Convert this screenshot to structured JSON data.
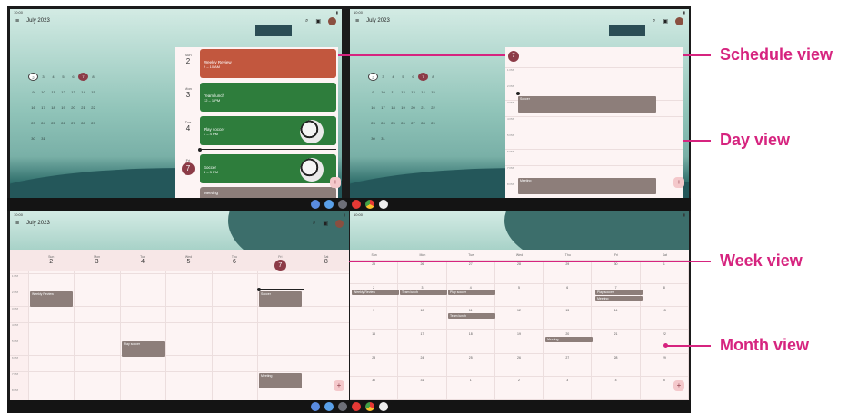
{
  "app": {
    "month_title": "July 2023"
  },
  "mini_calendar": [
    "2",
    "3",
    "4",
    "5",
    "6",
    "7",
    "8",
    "9",
    "10",
    "11",
    "12",
    "13",
    "14",
    "15",
    "16",
    "17",
    "18",
    "19",
    "20",
    "21",
    "22",
    "23",
    "24",
    "25",
    "26",
    "27",
    "28",
    "29",
    "30",
    "31"
  ],
  "schedule": [
    {
      "dow": "Sun",
      "day": "2",
      "title": "Weekly Review",
      "time": "9 – 10 AM",
      "color": "#c2573e"
    },
    {
      "dow": "Mon",
      "day": "3",
      "title": "Team lunch",
      "time": "12 – 1 PM",
      "color": "#2e7d3c"
    },
    {
      "dow": "Tue",
      "day": "4",
      "title": "Play soccer",
      "time": "3 – 4 PM",
      "color": "#2e7d3c"
    },
    {
      "dow": "Fri",
      "day": "7",
      "title": "Soccer",
      "time": "2 – 3 PM",
      "color": "#2e7d3c"
    },
    {
      "dow": "",
      "day": "",
      "title": "Meeting",
      "time": "",
      "color": "#8d7e7a"
    }
  ],
  "day_view": {
    "hours": [
      "1 PM",
      "2 PM",
      "3 PM",
      "4 PM",
      "5 PM",
      "6 PM",
      "7 PM",
      "8 PM",
      "9 PM"
    ],
    "events": [
      {
        "title": "Soccer"
      },
      {
        "title": "Meeting"
      }
    ]
  },
  "week_view": {
    "days": [
      {
        "dow": "Sun",
        "num": "2"
      },
      {
        "dow": "Mon",
        "num": "3"
      },
      {
        "dow": "Tue",
        "num": "4"
      },
      {
        "dow": "Wed",
        "num": "5"
      },
      {
        "dow": "Thu",
        "num": "6"
      },
      {
        "dow": "Fri",
        "num": "7"
      },
      {
        "dow": "Sat",
        "num": "8"
      }
    ],
    "hours": [
      "1 PM",
      "2 PM",
      "3 PM",
      "4 PM",
      "5 PM",
      "6 PM",
      "7 PM",
      "8 PM",
      "9 PM"
    ],
    "events": [
      {
        "title": "Weekly Review"
      },
      {
        "title": "Play soccer"
      },
      {
        "title": "Soccer"
      },
      {
        "title": "Meeting"
      }
    ]
  },
  "month_view": {
    "days_of_week": [
      "Sun",
      "Mon",
      "Tue",
      "Wed",
      "Thu",
      "Fri",
      "Sat"
    ],
    "cells": [
      "25",
      "26",
      "27",
      "28",
      "29",
      "30",
      "1",
      "2",
      "3",
      "4",
      "5",
      "6",
      "7",
      "8",
      "9",
      "10",
      "11",
      "12",
      "13",
      "14",
      "15",
      "16",
      "17",
      "18",
      "19",
      "20",
      "21",
      "22",
      "23",
      "24",
      "25",
      "26",
      "27",
      "28",
      "29",
      "30",
      "31",
      "1",
      "2",
      "3",
      "4",
      "5"
    ],
    "events": [
      {
        "title": "Weekly Review"
      },
      {
        "title": "Team lunch"
      },
      {
        "title": "Play soccer"
      },
      {
        "title": "Team lunch"
      },
      {
        "title": "Meeting"
      },
      {
        "title": "Play soccer"
      },
      {
        "title": "Meeting"
      }
    ]
  },
  "callouts": {
    "schedule": "Schedule view",
    "day": "Day view",
    "week": "Week view",
    "month": "Month view"
  },
  "colors": {
    "accent": "#d6247f",
    "selected_day": "#8c3b47",
    "event": "#8d7e7a"
  }
}
